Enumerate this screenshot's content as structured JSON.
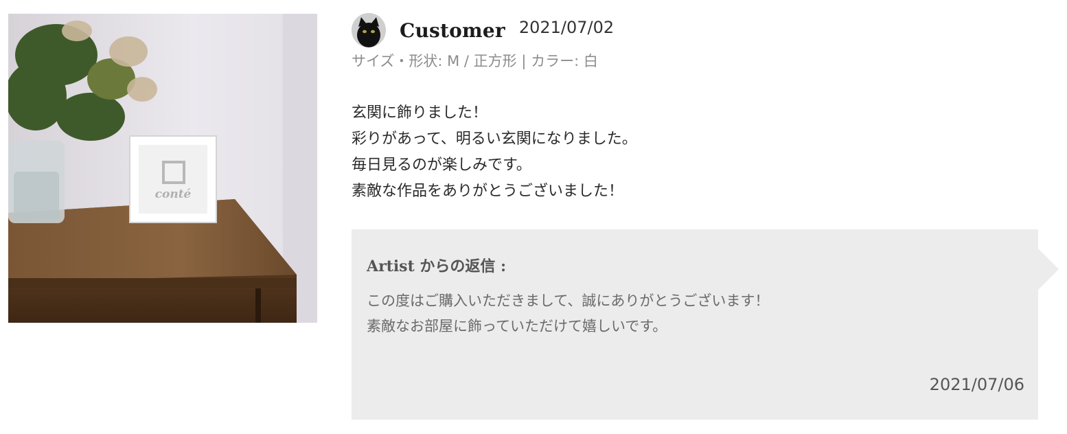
{
  "review": {
    "customer_name": "Customer",
    "date": "2021/07/02",
    "variant": "サイズ・形状: M / 正方形 | カラー: 白",
    "body_lines": [
      "玄関に飾りました！",
      "彩りがあって、明るい玄関になりました。",
      "毎日見るのが楽しみです。",
      "素敵な作品をありがとうございました！"
    ]
  },
  "photo": {
    "frame_logo_text": "conté"
  },
  "reply": {
    "title": "Artist からの返信 :",
    "lines": [
      "この度はご購入いただきまして、誠にありがとうございます！",
      "素敵なお部屋に飾っていただけて嬉しいです。"
    ],
    "date": "2021/07/06"
  }
}
